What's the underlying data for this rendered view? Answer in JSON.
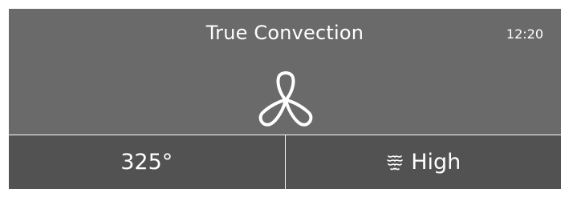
{
  "header": {
    "mode_title": "True Convection",
    "clock": "12:20",
    "mode_icon": "fan-icon"
  },
  "controls": {
    "temperature": "325°",
    "fan_speed_icon": "convection-icon",
    "fan_speed": "High"
  },
  "colors": {
    "header_bg": "#6a6a6a",
    "panel_bg": "#525252",
    "text": "#ffffff",
    "divider": "#ffffff"
  }
}
